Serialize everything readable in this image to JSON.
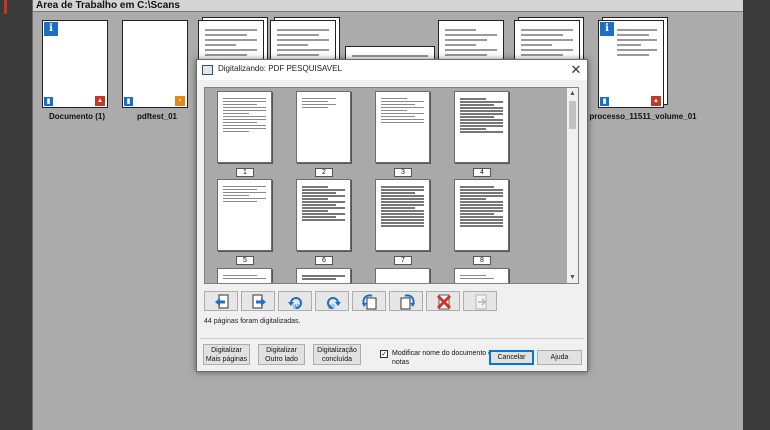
{
  "workspace": {
    "title": "Área de Trabalho em C:\\Scans",
    "documents": [
      {
        "label": "Documento (1)",
        "badge": "pdf"
      },
      {
        "label": "pdftest_01",
        "badge": "image"
      },
      {
        "label": "",
        "badge": "none"
      },
      {
        "label": "",
        "badge": "none"
      },
      {
        "label": "",
        "badge": "none"
      },
      {
        "label": "",
        "badge": "none"
      },
      {
        "label": "",
        "badge": "none"
      },
      {
        "label": "processo_11511_volume_01",
        "badge": "pdf"
      }
    ]
  },
  "dialog": {
    "title": "Digitalizando: PDF PESQUISAVEL",
    "close_symbol": "✕",
    "pages": [
      "1",
      "2",
      "3",
      "4",
      "5",
      "6",
      "7",
      "8"
    ],
    "status_text": "44 páginas foram digitalizadas.",
    "toolbar_icons": [
      "move-left-icon",
      "move-right-icon",
      "rotate-left-90-icon",
      "rotate-right-90-icon",
      "rotate-ccw-icon",
      "rotate-cw-icon",
      "delete-page-icon",
      "next-page-icon"
    ],
    "buttons": {
      "scan_more_line1": "Digitalizar",
      "scan_more_line2": "Mais páginas",
      "scan_other_line1": "Digitalizar",
      "scan_other_line2": "Outro lado",
      "done_line1": "Digitalização",
      "done_line2": "concluída",
      "cancel": "Cancelar",
      "help": "Ajuda"
    },
    "rename_checkbox": {
      "checked": true,
      "mark": "✓",
      "label": "Modificar nome do documento e notas"
    }
  },
  "colors": {
    "workspace_bg": "#ababab",
    "viewer_bg": "#a9a9a9",
    "info_badge": "#1b6fc4",
    "pdf_badge": "#c0392b",
    "delete_icon": "#d32f2f"
  }
}
